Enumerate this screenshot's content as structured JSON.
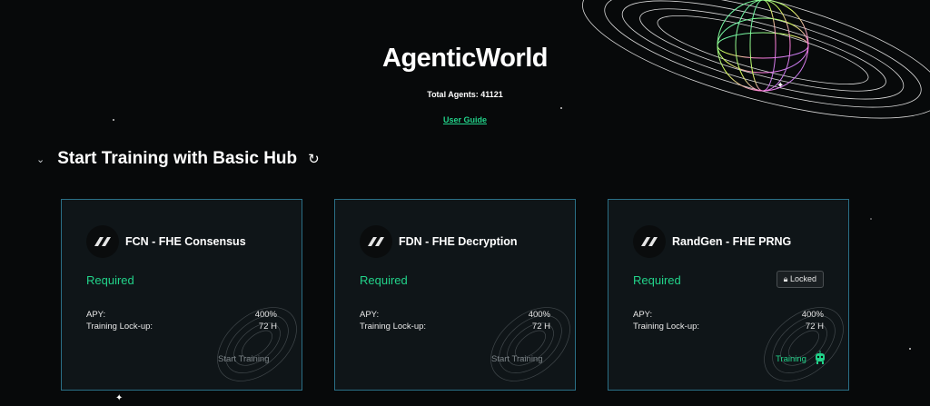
{
  "header": {
    "title": "AgenticWorld",
    "total_agents": "Total Agents: 41121",
    "user_guide": "User Guide"
  },
  "section": {
    "title": "Start Training with Basic Hub",
    "collapse_icon": "chevron-down-icon",
    "refresh_icon": "refresh-icon"
  },
  "cards": [
    {
      "name": "FCN - FHE Consensus",
      "status": "Required",
      "apy_label": "APY:",
      "apy_value": "400%",
      "lockup_label": "Training Lock-up:",
      "lockup_value": "72 H",
      "action": "Start Training"
    },
    {
      "name": "FDN - FHE Decryption",
      "status": "Required",
      "apy_label": "APY:",
      "apy_value": "400%",
      "lockup_label": "Training Lock-up:",
      "lockup_value": "72 H",
      "action": "Start Training"
    },
    {
      "name": "RandGen - FHE PRNG",
      "status": "Required",
      "locked": "Locked",
      "apy_label": "APY:",
      "apy_value": "400%",
      "lockup_label": "Training Lock-up:",
      "lockup_value": "72 H",
      "action": "Training"
    }
  ],
  "colors": {
    "accent": "#22d38a",
    "card_border": "#2a6f86",
    "background": "#07090a"
  }
}
